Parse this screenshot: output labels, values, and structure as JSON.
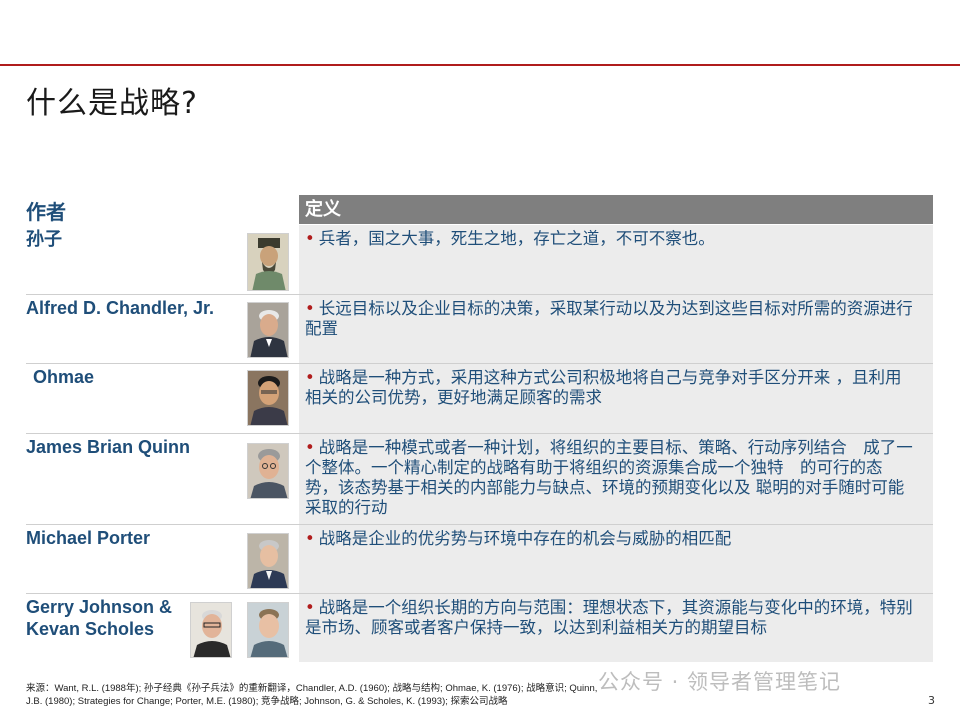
{
  "slide": {
    "title": "什么是战略?",
    "page_number": "3"
  },
  "table": {
    "headers": {
      "author": "作者",
      "definition": "定义"
    },
    "rows": [
      {
        "author": "孙子",
        "definition": "兵者，国之大事，死生之地，存亡之道，不可不察也。"
      },
      {
        "author": "Alfred D. Chandler, Jr.",
        "definition": "长远目标以及企业目标的决策，采取某行动以及为达到这些目标对所需的资源进行配置"
      },
      {
        "author": "Ohmae",
        "definition": "战略是一种方式，采用这种方式公司积极地将自己与竞争对手区分开来 ，且利用相关的公司优势，更好地满足顾客的需求"
      },
      {
        "author": "James Brian Quinn",
        "definition": "战略是一种模式或者一种计划，将组织的主要目标、策略、行动序列结合　成了一个整体。一个精心制定的战略有助于将组织的资源集合成一个独特　的可行的态势，该态势基于相关的内部能力与缺点、环境的预期变化以及 聪明的对手随时可能采取的行动"
      },
      {
        "author": "Michael Porter",
        "definition": "战略是企业的优劣势与环境中存在的机会与威胁的相匹配"
      },
      {
        "author": "Gerry Johnson & Kevan Scholes",
        "definition": "战略是一个组织长期的方向与范围：理想状态下，其资源能与变化中的环境，特别是市场、顾客或者客户保持一致，以达到利益相关方的期望目标"
      }
    ]
  },
  "footnote": {
    "line1": "来源：Want, R.L. (1988年); 孙子经典《孙子兵法》的重新翻译，Chandler, A.D. (1960); 战略与结构; Ohmae, K. (1976); 战略意识; Quinn,",
    "line2": "J.B. (1980); Strategies  for Change; Porter, M.E. (1980); 竞争战略; Johnson, G. & Scholes, K. (1993); 探索公司战略"
  },
  "watermark": "公众号 · 领导者管理笔记",
  "colors": {
    "accent_red": "#b01c1c",
    "author_blue": "#1f4e79",
    "header_gray": "#7f7f7f",
    "row_bg": "#ececec"
  }
}
